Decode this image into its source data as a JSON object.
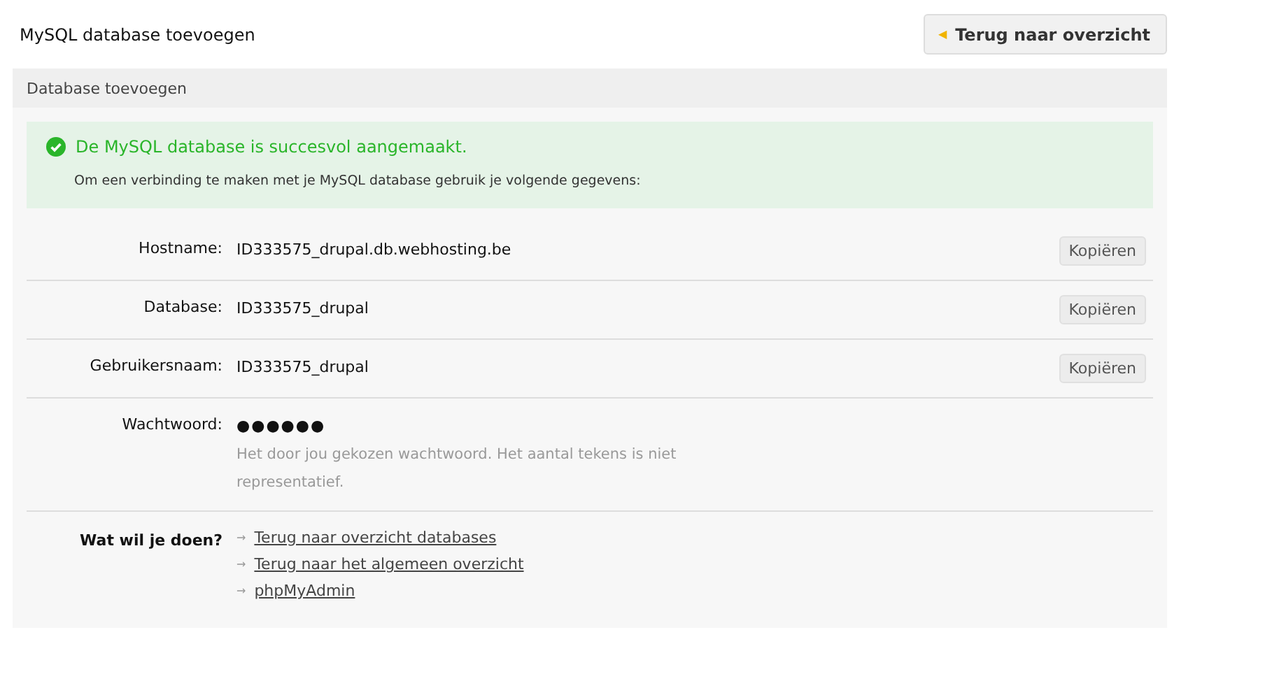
{
  "page_title": "MySQL database toevoegen",
  "back_button": {
    "icon": "◀",
    "label": "Terug naar overzicht"
  },
  "panel": {
    "title": "Database toevoegen",
    "success": {
      "title": "De MySQL database is succesvol aangemaakt.",
      "text": "Om een verbinding te maken met je MySQL database gebruik je volgende gegevens:"
    },
    "fields": [
      {
        "kind": "copyable",
        "label": "Hostname:",
        "value": "ID333575_drupal.db.webhosting.be",
        "button": "Kopiëren"
      },
      {
        "kind": "copyable",
        "label": "Database:",
        "value": "ID333575_drupal",
        "button": "Kopiëren"
      },
      {
        "kind": "copyable",
        "label": "Gebruikersnaam:",
        "value": "ID333575_drupal",
        "button": "Kopiëren"
      },
      {
        "kind": "secret",
        "label": "Wachtwoord:",
        "value": "●●●●●●",
        "hint": "Het door jou gekozen wachtwoord. Het aantal tekens is niet representatief."
      }
    ],
    "actions": {
      "label": "Wat wil je doen?",
      "links": [
        {
          "arrow": "→",
          "label": "Terug naar overzicht databases"
        },
        {
          "arrow": "→",
          "label": "Terug naar het algemeen overzicht"
        },
        {
          "arrow": "→",
          "label": "phpMyAdmin"
        }
      ]
    }
  }
}
